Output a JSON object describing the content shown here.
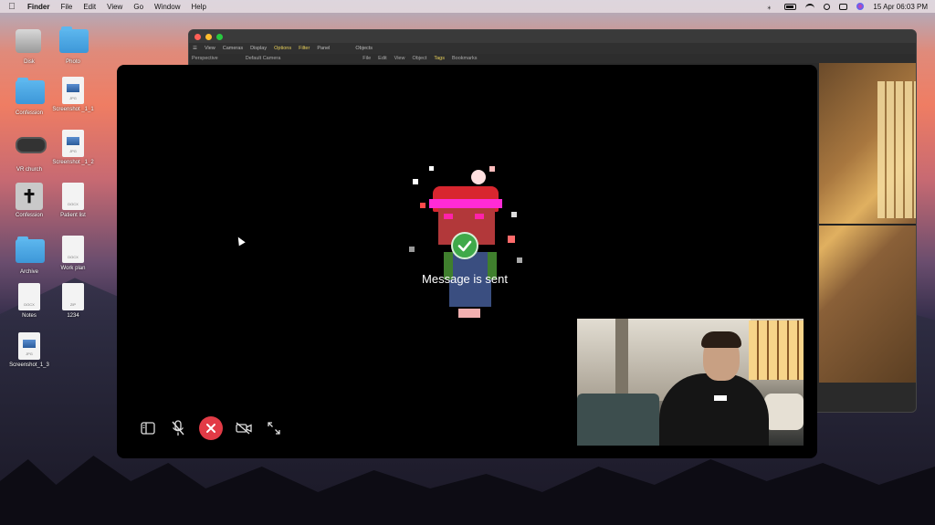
{
  "menubar": {
    "app_name": "Finder",
    "menus": [
      "File",
      "Edit",
      "View",
      "Go",
      "Window",
      "Help"
    ],
    "datetime": "15 Apr 06:03 PM"
  },
  "desktop": {
    "icons": [
      {
        "label": "Disk",
        "icon": "disk-icon"
      },
      {
        "label": "Photo",
        "icon": "folder-icon"
      },
      {
        "label": "Confession",
        "icon": "folder-icon"
      },
      {
        "label": "Screenshot _1_1",
        "icon": "jpg-file-icon",
        "tag": "JPG"
      },
      {
        "label": "VR church",
        "icon": "vr-headset-icon"
      },
      {
        "label": "Screenshot _1_2",
        "icon": "jpg-file-icon",
        "tag": "JPG"
      },
      {
        "label": "Confession",
        "icon": "cross-icon"
      },
      {
        "label": "Patient list",
        "icon": "docx-file-icon",
        "tag": "DOCX"
      },
      {
        "label": "Archive",
        "icon": "folder-icon"
      },
      {
        "label": "Work plan",
        "icon": "docx-file-icon",
        "tag": "DOCX"
      },
      {
        "label": "Notes",
        "icon": "docx-file-icon",
        "tag": "DOCX"
      },
      {
        "label": "1234",
        "icon": "zip-file-icon",
        "tag": "ZIP"
      },
      {
        "label": "Screenshot_1_3",
        "icon": "jpg-file-icon",
        "tag": "JPG"
      }
    ]
  },
  "background_window": {
    "toolbar": [
      "View",
      "Cameras",
      "Display",
      "Options",
      "Filter",
      "Panel"
    ],
    "highlighted_toolbar": "Options",
    "viewport_label": "Perspective",
    "camera_label": "Default Camera",
    "objects_tab": "Objects",
    "objects_menu": [
      "File",
      "Edit",
      "View",
      "Object",
      "Tags",
      "Bookmarks"
    ],
    "highlighted_objects_menu": "Tags"
  },
  "call": {
    "status_message": "Message is sent",
    "controls": [
      "sidebar-toggle",
      "mute-mic",
      "end-call",
      "video-off",
      "fullscreen"
    ],
    "end_call_color": "#e23b46",
    "success_color": "#3fa94a"
  }
}
